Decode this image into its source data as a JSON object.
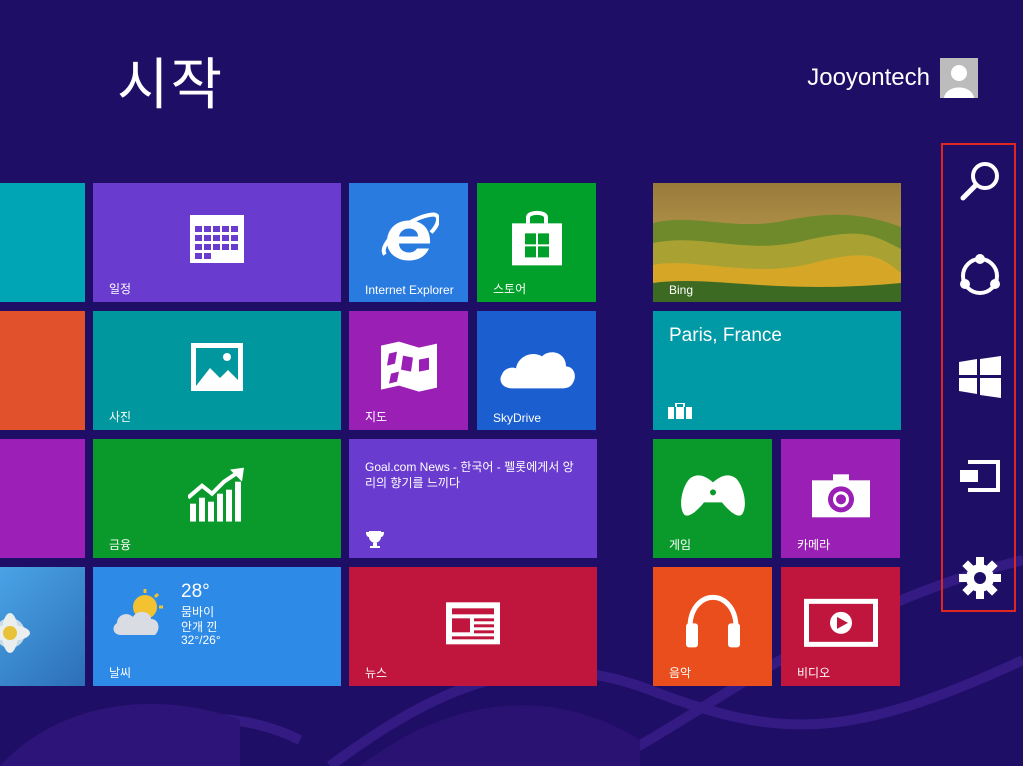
{
  "start": {
    "title": "시작"
  },
  "user": {
    "name": "Jooyontech"
  },
  "tiles": {
    "calendar": {
      "label": "일정",
      "color": "#6a3bcf"
    },
    "ie": {
      "label": "Internet Explorer",
      "color": "#2a7be0"
    },
    "store": {
      "label": "스토어",
      "color": "#00a02a"
    },
    "bing": {
      "label": "Bing"
    },
    "photos": {
      "label": "사진",
      "color": "#00979e"
    },
    "maps": {
      "label": "지도",
      "color": "#9a1fb4"
    },
    "skydrive": {
      "label": "SkyDrive",
      "color": "#1b5ed0"
    },
    "travel": {
      "city": "Paris, France",
      "color": "#009aa6"
    },
    "finance": {
      "label": "금융",
      "color": "#0a9a2c"
    },
    "news_live": {
      "text": "Goal.com News - 한국어 - 펠롯에게서 앙리의 향기를 느끼다",
      "color": "#6a3bcf"
    },
    "games": {
      "label": "게임",
      "color": "#0a9a2c"
    },
    "camera": {
      "label": "카메라",
      "color": "#9a1fb4"
    },
    "weather": {
      "label": "날씨",
      "temp": "28°",
      "city": "뭄바이",
      "condition": "안개 낀",
      "range": "32°/26°",
      "color": "#2d8ae6"
    },
    "news": {
      "label": "뉴스",
      "color": "#c0163e"
    },
    "music": {
      "label": "음악",
      "color": "#ea4e1d"
    },
    "video": {
      "label": "비디오",
      "color": "#c0163e"
    }
  },
  "charms": {
    "items": [
      "search-icon",
      "share-icon",
      "start-icon",
      "devices-icon",
      "settings-icon"
    ],
    "highlight_color": "#e0261e"
  }
}
